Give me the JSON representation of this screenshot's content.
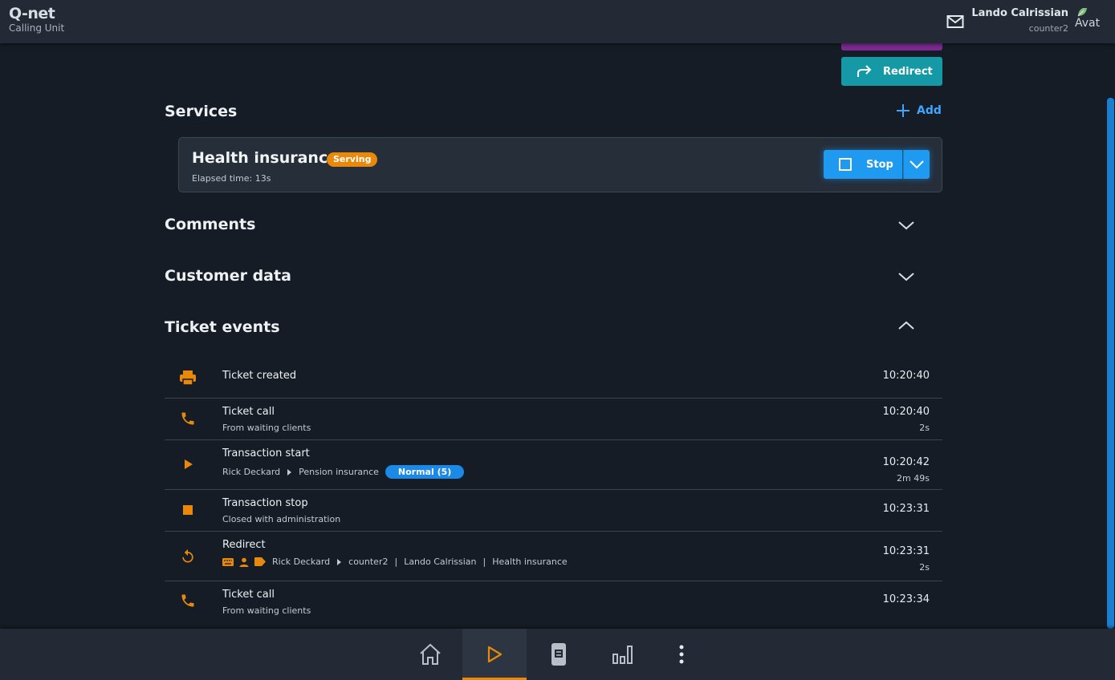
{
  "app": {
    "logo": "Q-net",
    "subtitle": "Calling Unit"
  },
  "user": {
    "name": "Lando Calrissian",
    "counter": "counter2",
    "avatar_alt": "Avat"
  },
  "actions": {
    "redirect_label": "Redirect"
  },
  "services": {
    "title": "Services",
    "add_label": "Add",
    "current": {
      "name": "Health insurance",
      "status": "Serving",
      "elapsed": "Elapsed time: 13s",
      "stop_label": "Stop"
    }
  },
  "sections": {
    "comments": "Comments",
    "customer_data": "Customer data",
    "ticket_events": "Ticket events"
  },
  "events": [
    {
      "icon": "printer-icon",
      "title": "Ticket created",
      "time": "10:20:40"
    },
    {
      "icon": "phone-icon",
      "title": "Ticket call",
      "subtitle": "From waiting clients",
      "time": "10:20:40",
      "duration": "2s"
    },
    {
      "icon": "play-icon",
      "title": "Transaction start",
      "agent": "Rick Deckard",
      "service": "Pension insurance",
      "badge": "Normal (5)",
      "time": "10:20:42",
      "duration": "2m 49s"
    },
    {
      "icon": "stop-icon",
      "title": "Transaction stop",
      "subtitle": "Closed with administration",
      "time": "10:23:31"
    },
    {
      "icon": "redirect-icon",
      "title": "Redirect",
      "agent": "Rick Deckard",
      "counter": "counter2",
      "user": "Lando Calrissian",
      "service": "Health insurance",
      "time": "10:23:31",
      "duration": "2s"
    },
    {
      "icon": "phone-icon",
      "title": "Ticket call",
      "subtitle": "From waiting clients",
      "time": "10:23:34"
    }
  ],
  "colors": {
    "background": "#161c25",
    "accent_orange": "#e8890c",
    "accent_blue": "#1e9bf0",
    "teal": "#1699a6",
    "purple": "#7b2a92"
  }
}
